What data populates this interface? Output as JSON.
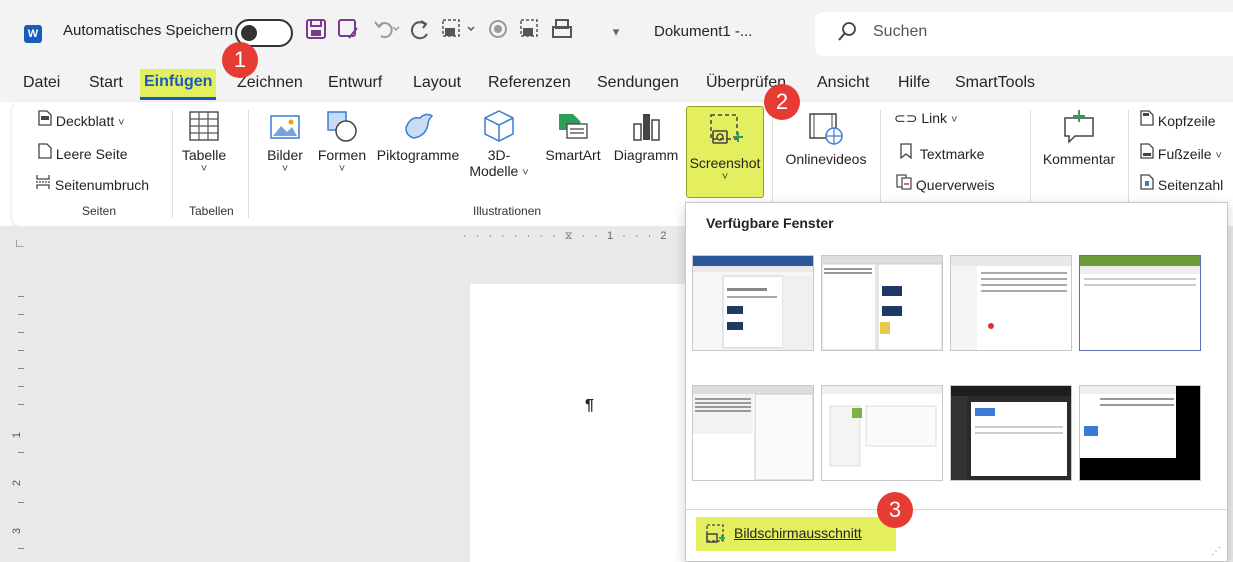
{
  "titlebar": {
    "app_icon": "W",
    "autosave_label": "Automatisches Speichern",
    "document_title": "Dokument1 -...",
    "search_placeholder": "Suchen",
    "qat_icons": [
      "save-icon",
      "save-as-icon",
      "undo-icon",
      "redo-icon",
      "screenshot-qat-icon",
      "record-icon",
      "insert-picture-icon",
      "print-icon",
      "customize-dropdown-icon"
    ]
  },
  "menu": {
    "items": [
      "Datei",
      "Start",
      "Einfügen",
      "Zeichnen",
      "Entwurf",
      "Layout",
      "Referenzen",
      "Sendungen",
      "Überprüfen",
      "Ansicht",
      "Hilfe",
      "SmartTools"
    ],
    "active": "Einfügen"
  },
  "ribbon": {
    "seiten": {
      "label": "Seiten",
      "deckblatt": "Deckblatt",
      "leere_seite": "Leere Seite",
      "seitenumbruch": "Seitenumbruch"
    },
    "tabellen": {
      "label": "Tabellen",
      "tabelle": "Tabelle"
    },
    "illustrationen": {
      "label": "Illustrationen",
      "bilder": "Bilder",
      "formen": "Formen",
      "piktogramme": "Piktogramme",
      "modelle_line1": "3D-",
      "modelle_line2": "Modelle",
      "smartart": "SmartArt",
      "diagramm": "Diagramm",
      "screenshot": "Screenshot"
    },
    "medien": {
      "onlinevideos": "Onlinevideos"
    },
    "links": {
      "link": "Link",
      "textmarke": "Textmarke",
      "querverweis": "Querverweis"
    },
    "kommentare": {
      "kommentar": "Kommentar"
    },
    "kopf_fuss": {
      "kopfzeile": "Kopfzeile",
      "fusszeile": "Fußzeile",
      "seitenzahl": "Seitenzahl"
    }
  },
  "ruler": {
    "h_mark": "1",
    "h_mark2": "2",
    "v_marks": [
      "1",
      "2",
      "3"
    ]
  },
  "document": {
    "pilcrow": "¶"
  },
  "dropdown": {
    "header": "Verfügbare Fenster",
    "clip_label": "Bildschirmausschnitt",
    "thumbnail_count": 8
  },
  "badges": [
    "1",
    "2",
    "3"
  ],
  "colors": {
    "highlight": "#e4ef60",
    "badge": "#e53b33",
    "word_blue": "#185abd"
  }
}
